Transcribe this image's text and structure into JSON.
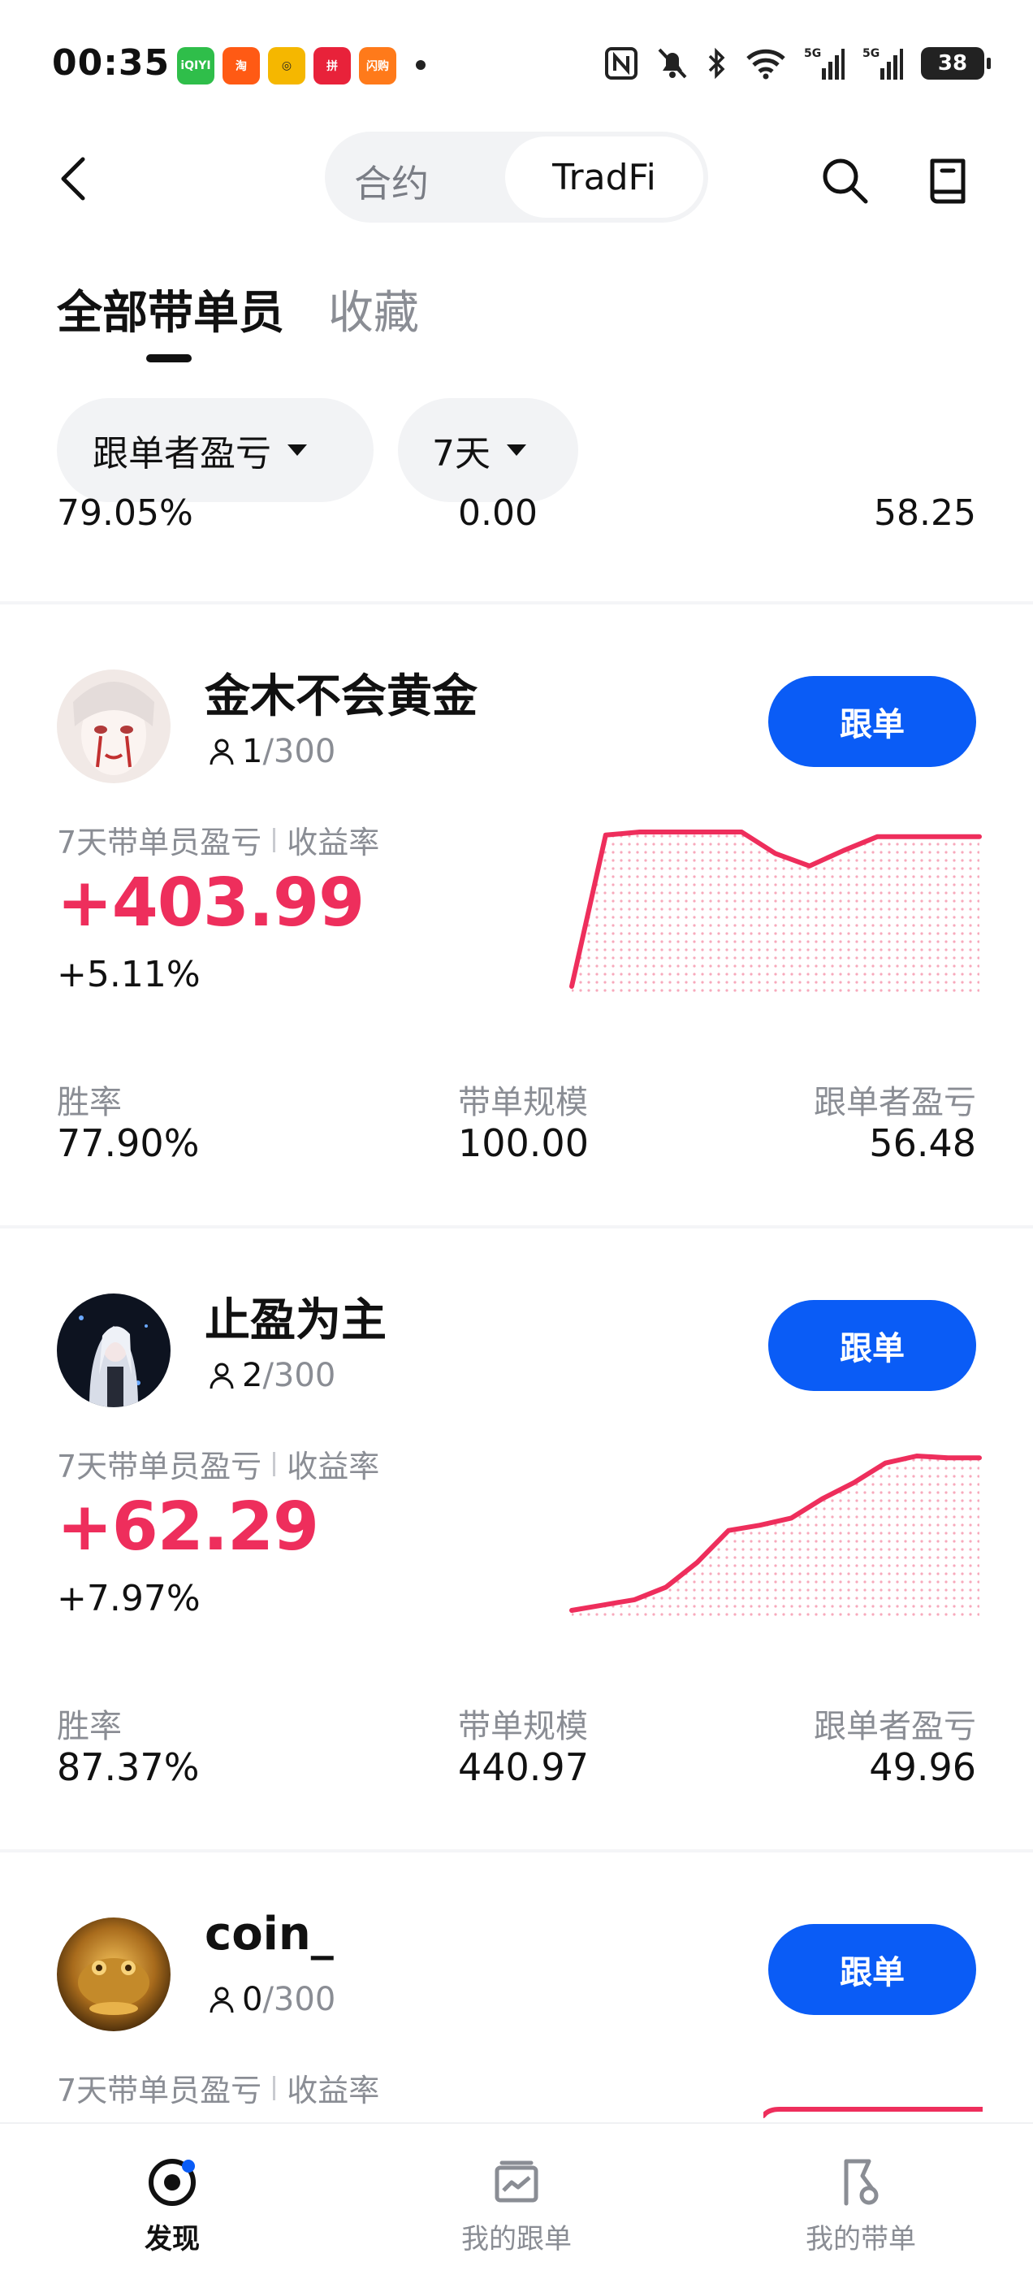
{
  "status_bar": {
    "time": "00:35",
    "battery": "38",
    "app_icons": [
      {
        "label": "iQIYI",
        "color": "#2fbe4a"
      },
      {
        "label": "淘",
        "color": "#ff5a14"
      },
      {
        "label": "◎",
        "color": "#f5b700"
      },
      {
        "label": "拼",
        "color": "#e8223a"
      },
      {
        "label": "闪购",
        "color": "#ff7a1a"
      }
    ]
  },
  "header": {
    "segment_contract": "合约",
    "segment_tradfi": "TradFi"
  },
  "tabs": {
    "all": "全部带单员",
    "favorites": "收藏"
  },
  "filters": {
    "sort": "跟单者盈亏",
    "period": "7天"
  },
  "partial_row": {
    "win_rate": "79.05%",
    "scale": "0.00",
    "follower_pnl": "58.25"
  },
  "labels": {
    "pnl_label": "7天带单员盈亏",
    "roi_label": "收益率",
    "win_rate": "胜率",
    "scale": "带单规模",
    "follower_pnl": "跟单者盈亏",
    "follow_button": "跟单"
  },
  "traders": [
    {
      "name": "金木不会黄金",
      "followers": "1",
      "max_followers": "/300",
      "pnl": "+403.99",
      "roi": "+5.11%",
      "win_rate": "77.90%",
      "scale": "100.00",
      "follower_pnl": "56.48",
      "sparkline": [
        0,
        9.8,
        10,
        10,
        10,
        10,
        8.6,
        7.8,
        8.8,
        9.7,
        9.7,
        9.7,
        9.7
      ]
    },
    {
      "name": "止盈为主",
      "followers": "2",
      "max_followers": "/300",
      "pnl": "+62.29",
      "roi": "+7.97%",
      "win_rate": "87.37%",
      "scale": "440.97",
      "follower_pnl": "49.96",
      "sparkline": [
        0,
        0.3,
        0.6,
        1.3,
        2.7,
        4.5,
        4.8,
        5.2,
        6.3,
        7.2,
        8.3,
        8.7,
        8.6,
        8.6
      ]
    },
    {
      "name": "coin_",
      "followers": "0",
      "max_followers": "/300",
      "pnl": "",
      "roi": "",
      "win_rate": "",
      "scale": "",
      "follower_pnl": "",
      "sparkline": []
    }
  ],
  "bottom_nav": {
    "discover": "发现",
    "my_follows": "我的跟单",
    "my_leads": "我的带单"
  },
  "colors": {
    "accent_blue": "#0a5cf6",
    "profit_red": "#ee2e5c"
  }
}
